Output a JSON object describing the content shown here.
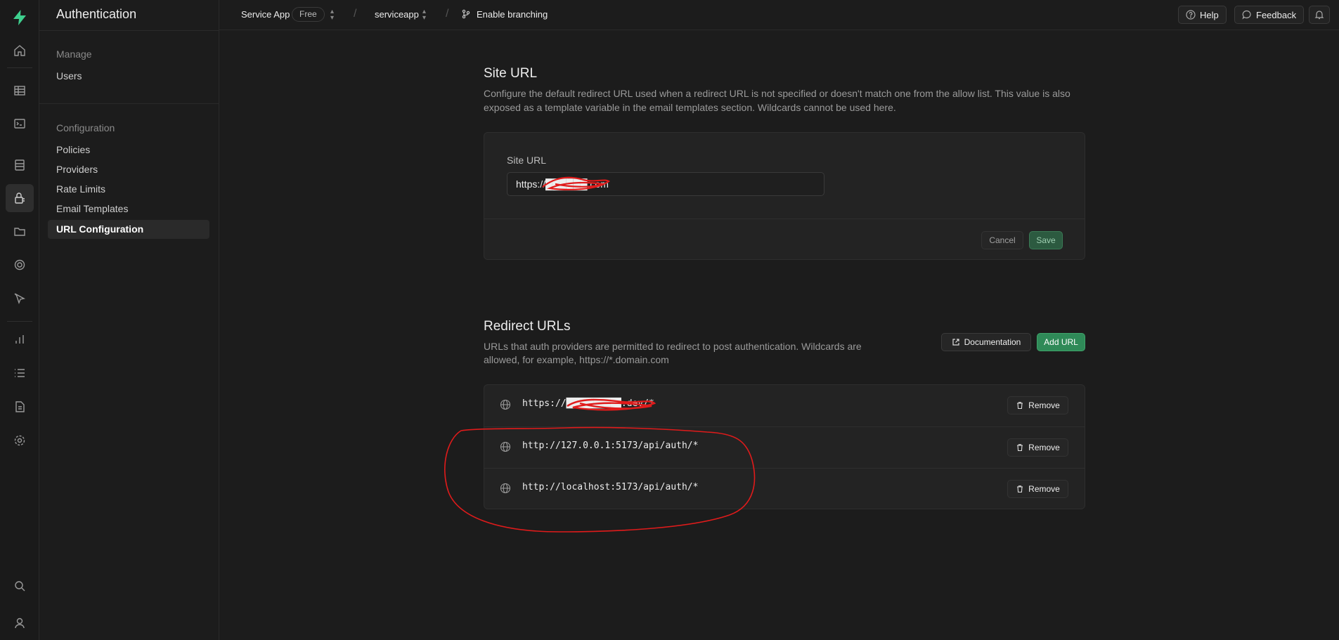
{
  "app": {
    "section_title": "Authentication"
  },
  "sidebar": {
    "groups": [
      {
        "label": "Manage",
        "items": [
          {
            "label": "Users"
          }
        ]
      },
      {
        "label": "Configuration",
        "items": [
          {
            "label": "Policies"
          },
          {
            "label": "Providers"
          },
          {
            "label": "Rate Limits"
          },
          {
            "label": "Email Templates"
          },
          {
            "label": "URL Configuration",
            "active": true
          }
        ]
      }
    ]
  },
  "topbar": {
    "org_name": "Service App",
    "plan_badge": "Free",
    "project_name": "serviceapp",
    "branching_label": "Enable branching",
    "help_label": "Help",
    "feedback_label": "Feedback"
  },
  "site_url": {
    "title": "Site URL",
    "description_line1": "Configure the default redirect URL used when a redirect URL is not specified or doesn't match one from the allow list. This value is also",
    "description_line2": "exposed as a template variable in the email templates section. Wildcards cannot be used here.",
    "field_label": "Site URL",
    "value": "https://██████.com",
    "cancel_label": "Cancel",
    "save_label": "Save"
  },
  "redirect_urls": {
    "title": "Redirect URLs",
    "description_line1": "URLs that auth providers are permitted to redirect to post authentication. Wildcards are",
    "description_line2": "allowed, for example, https://*.domain.com",
    "docs_label": "Documentation",
    "add_label": "Add URL",
    "remove_label": "Remove",
    "urls": [
      {
        "url": "https://██████████.dev/*"
      },
      {
        "url": "http://127.0.0.1:5173/api/auth/*"
      },
      {
        "url": "http://localhost:5173/api/auth/*"
      }
    ]
  },
  "icons": {
    "rail": [
      "logo-icon",
      "home-icon",
      "table-editor-icon",
      "sql-editor-icon",
      "database-icon",
      "auth-icon",
      "storage-icon",
      "realtime-icon",
      "edge-functions-icon",
      "reports-icon",
      "logs-icon",
      "api-docs-icon",
      "settings-icon",
      "search-icon",
      "user-icon"
    ]
  },
  "colors": {
    "accent_green": "#2f8a58",
    "annotation_red": "#e01b1b",
    "background": "#1c1c1c"
  }
}
